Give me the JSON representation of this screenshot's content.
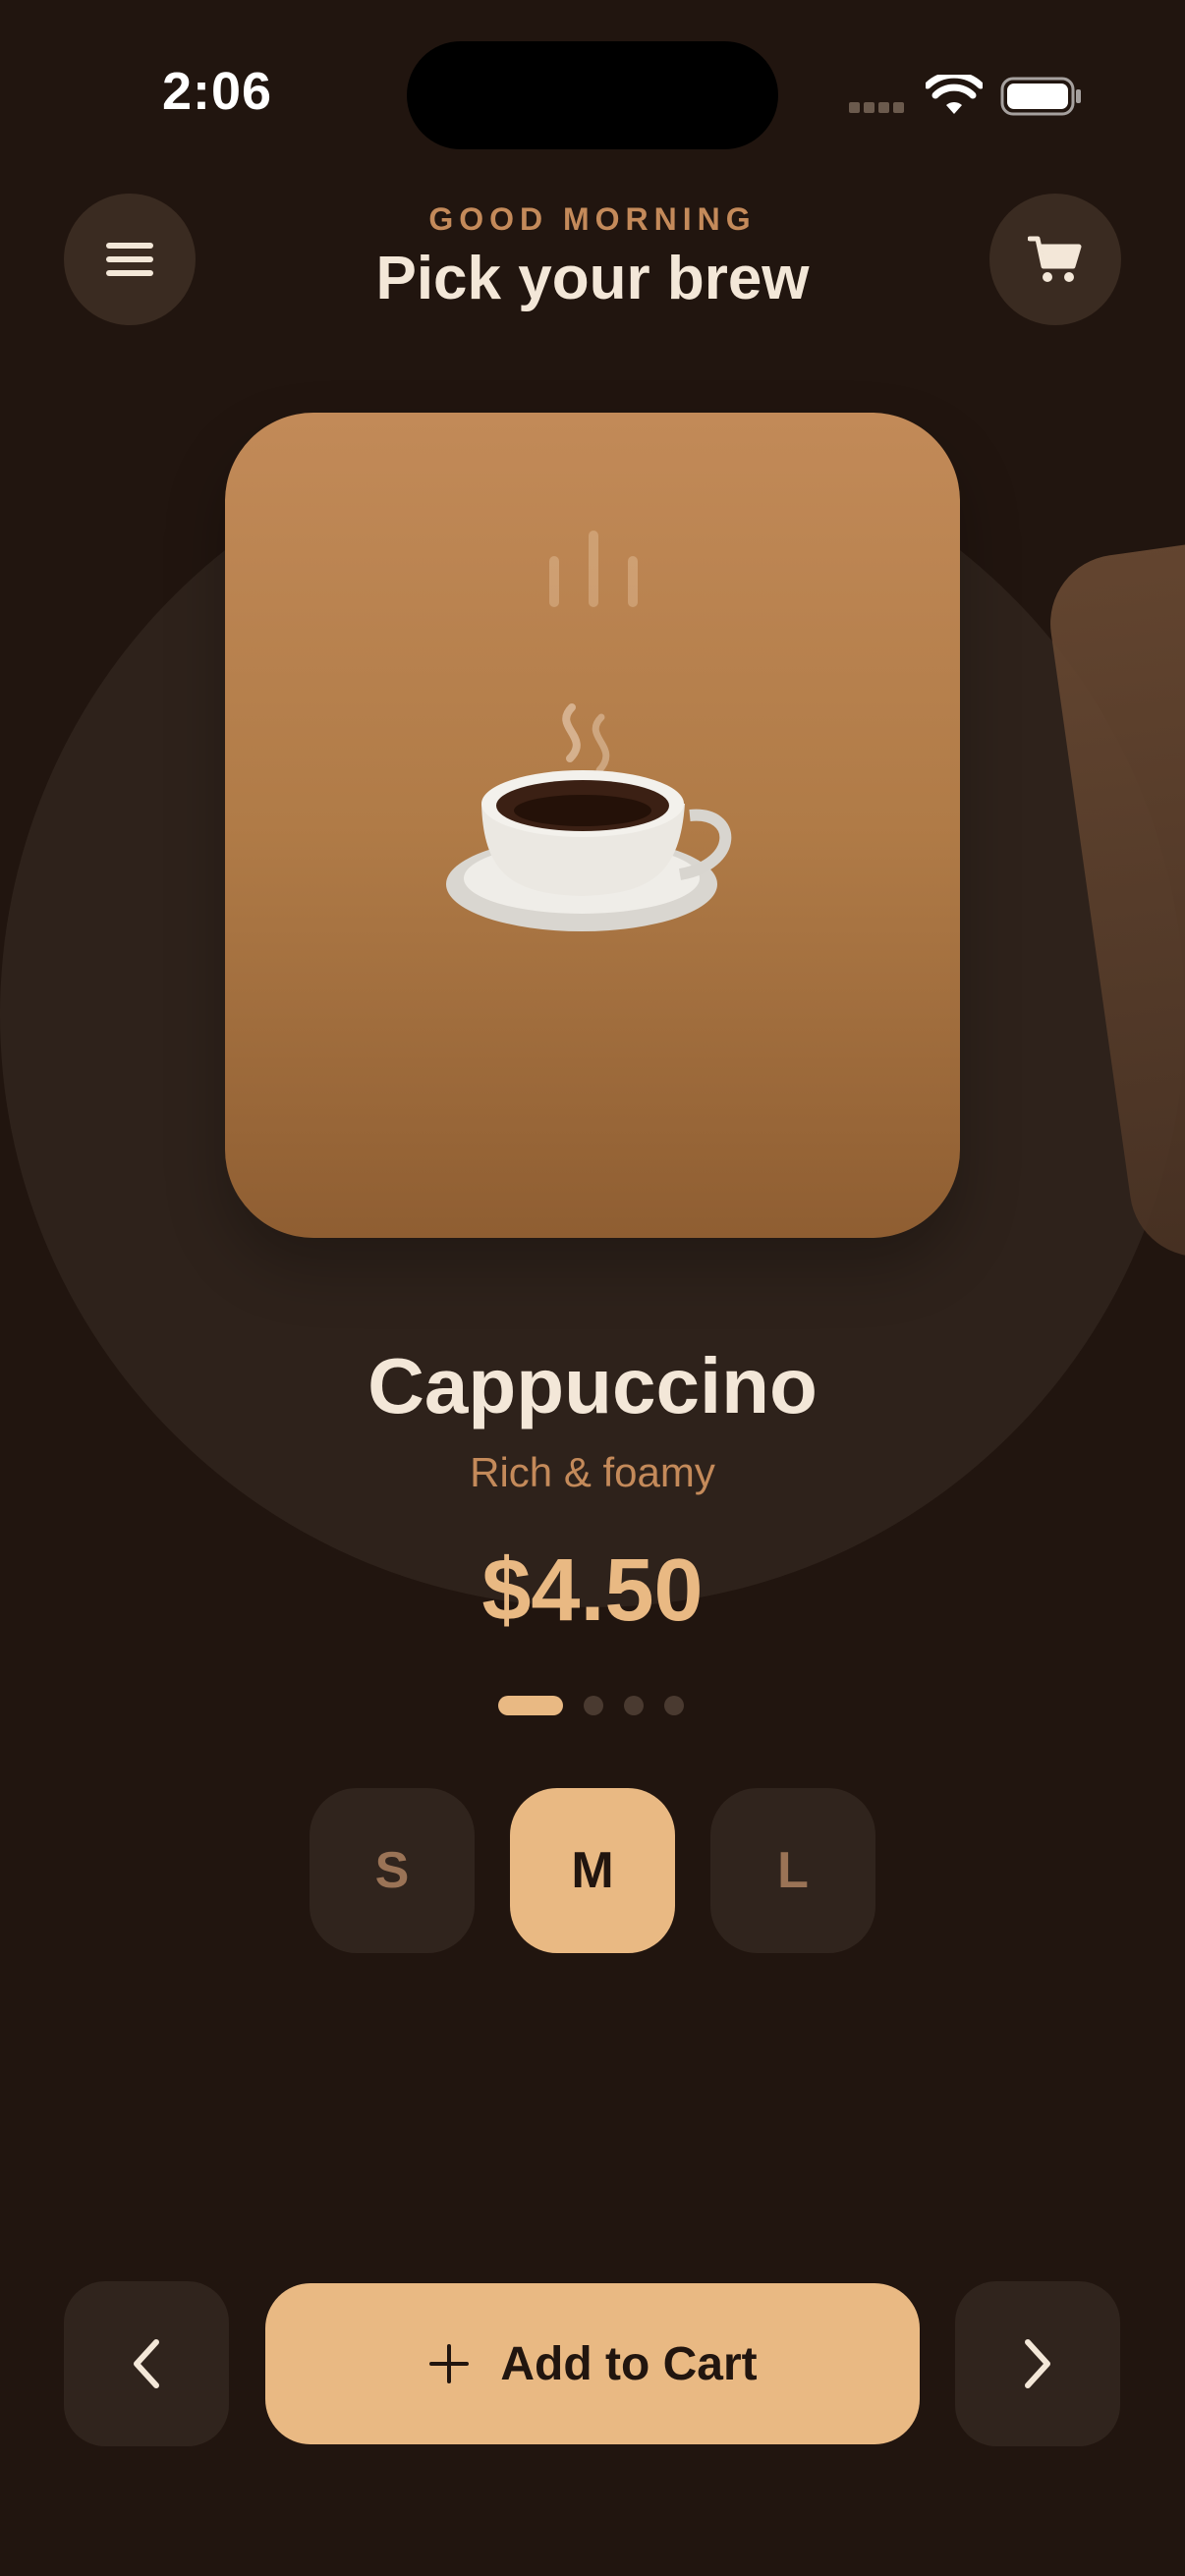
{
  "status_bar": {
    "time": "2:06"
  },
  "header": {
    "greeting": "GOOD MORNING",
    "title": "Pick your brew",
    "menu_icon": "hamburger-menu-icon",
    "cart_icon": "shopping-cart-icon"
  },
  "product": {
    "name": "Cappuccino",
    "description": "Rich & foamy",
    "price": "$4.50",
    "image_icon": "hot-coffee-cup-icon"
  },
  "carousel": {
    "pages": 4,
    "active_index": 0
  },
  "sizes": {
    "options": [
      "S",
      "M",
      "L"
    ],
    "selected": "M"
  },
  "actions": {
    "add_to_cart_label": "Add to Cart",
    "add_icon": "plus-icon",
    "prev_icon": "chevron-left-icon",
    "next_icon": "chevron-right-icon"
  },
  "colors": {
    "background": "#21150f",
    "accent": "#e9b983",
    "muted_accent": "#c48a5a",
    "text_primary": "#f3e7d8",
    "button_dark": "#30241d"
  }
}
